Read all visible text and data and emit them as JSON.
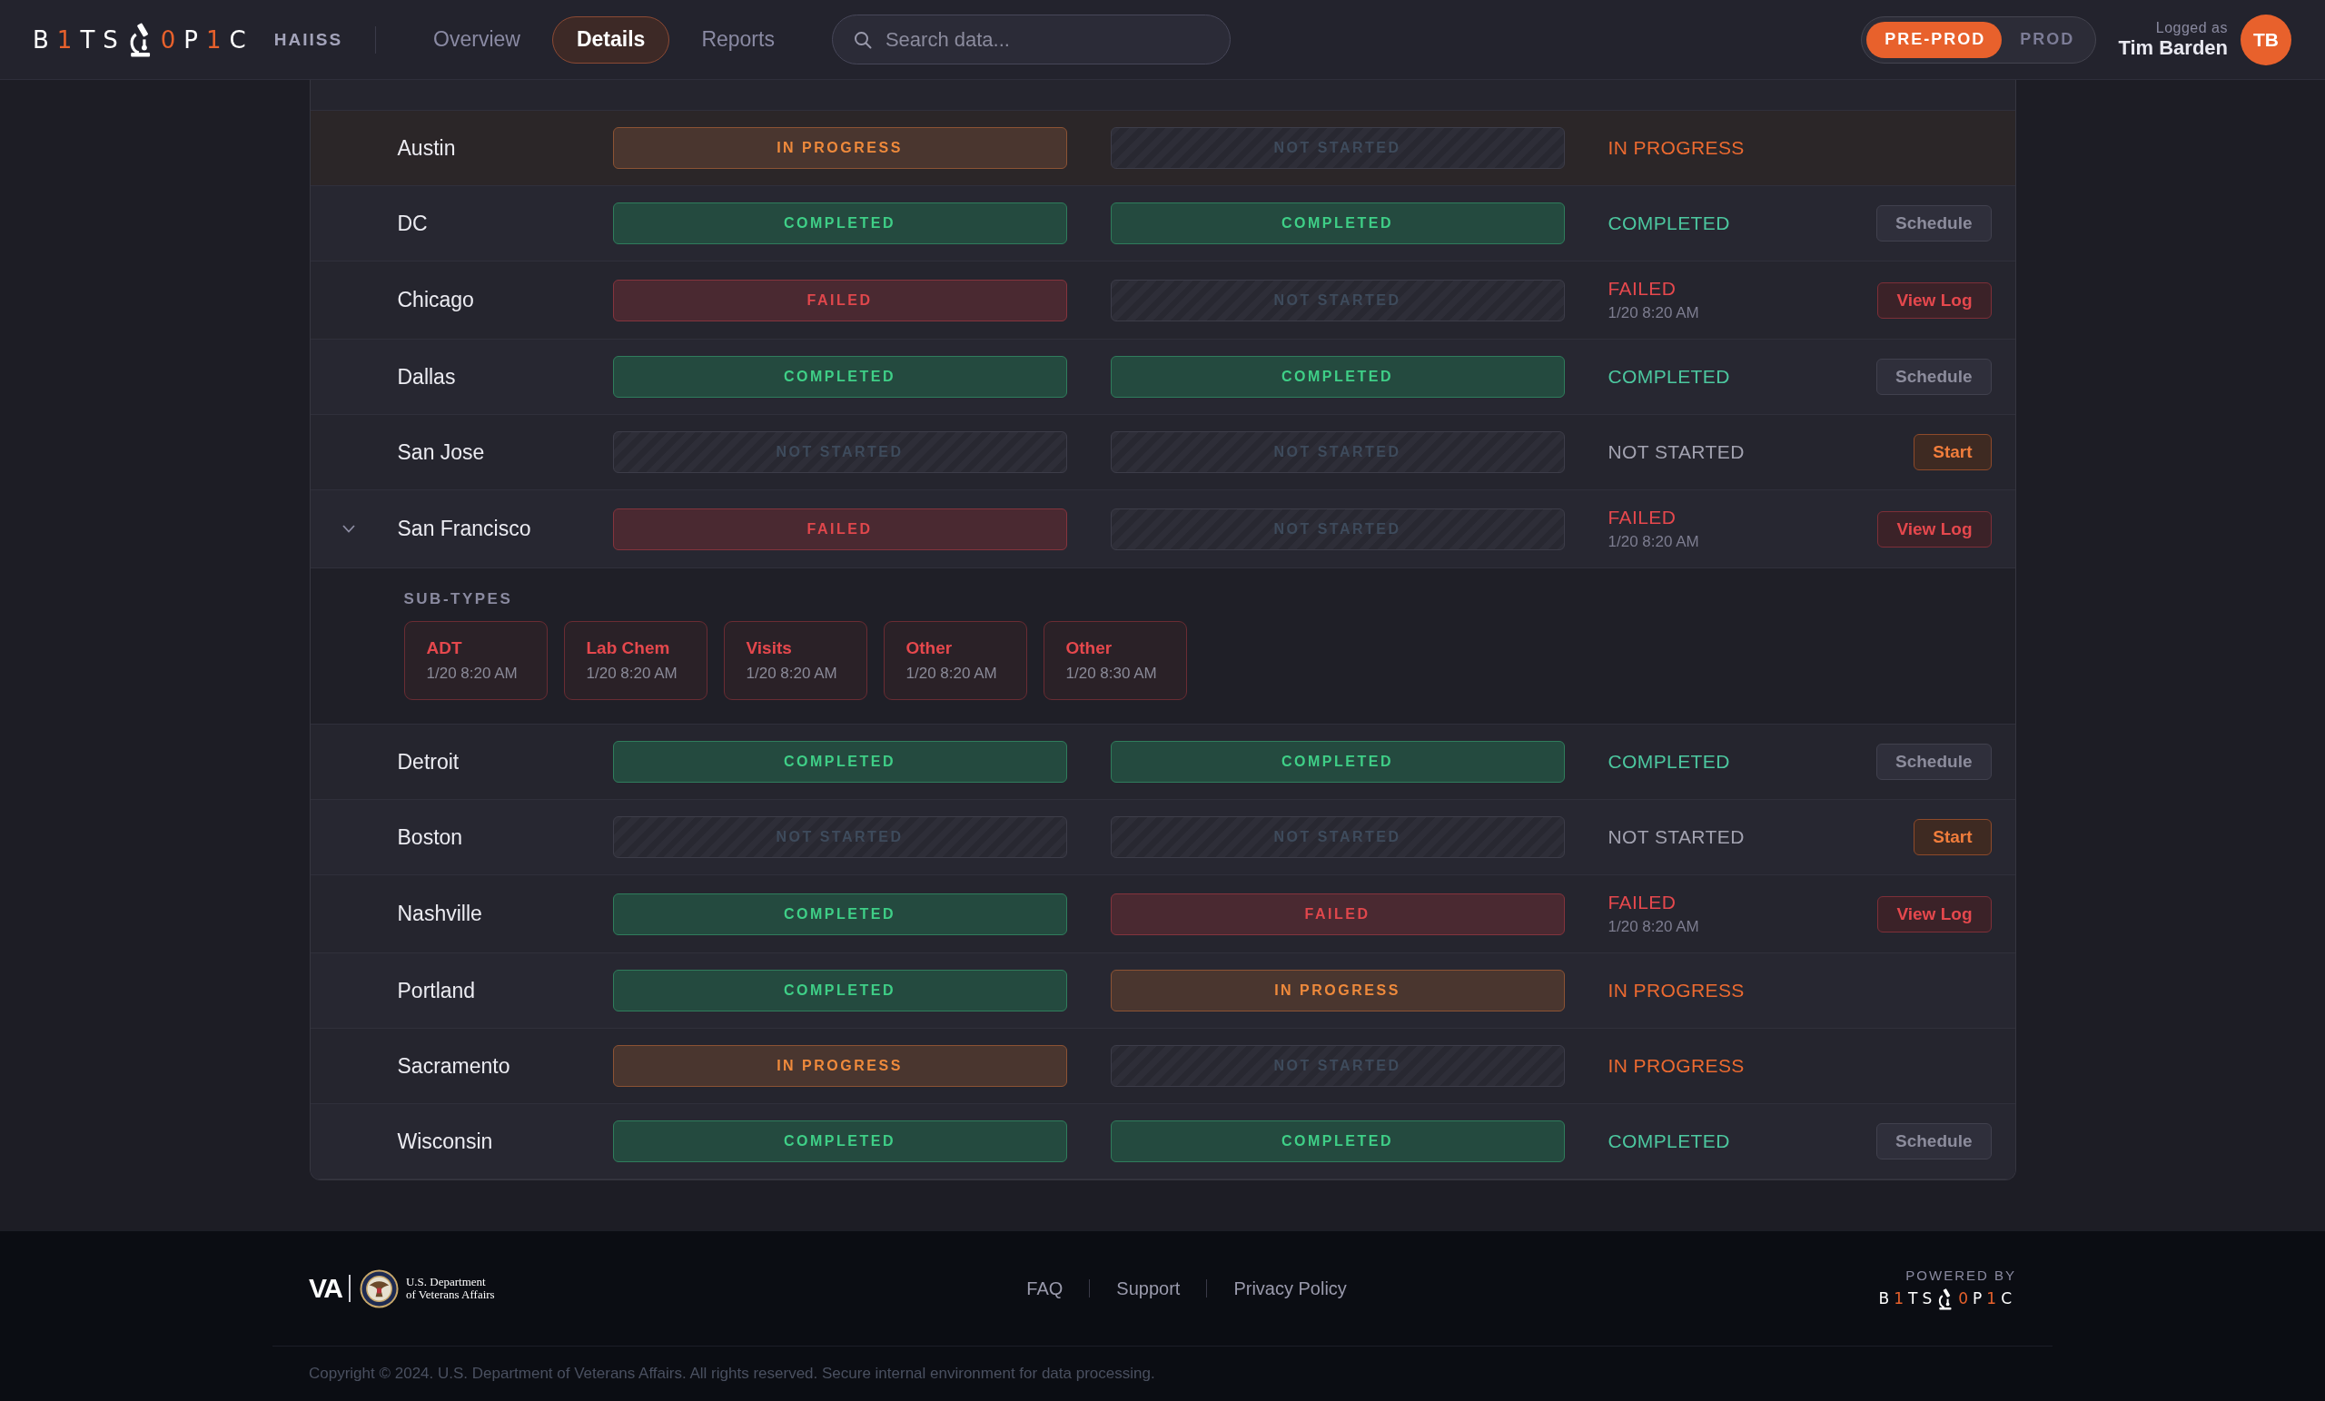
{
  "header": {
    "logo": {
      "before": [
        {
          "text": "B",
          "accent": false
        },
        {
          "text": "1",
          "accent": true
        },
        {
          "text": "TS",
          "accent": false
        }
      ],
      "after": [
        {
          "text": "0",
          "accent": true
        },
        {
          "text": "P",
          "accent": false
        },
        {
          "text": "1",
          "accent": true
        },
        {
          "text": "C",
          "accent": false
        }
      ]
    },
    "app_name": "HAIISS",
    "tabs": [
      {
        "label": "Overview",
        "selected": false
      },
      {
        "label": "Details",
        "selected": true
      },
      {
        "label": "Reports",
        "selected": false
      }
    ],
    "search": {
      "placeholder": "Search data..."
    },
    "environment": [
      {
        "label": "PRE-PROD",
        "selected": true
      },
      {
        "label": "PROD",
        "selected": false
      }
    ],
    "user": {
      "caption": "Logged as",
      "name": "Tim Barden",
      "initials": "TB"
    }
  },
  "table": {
    "rows": [
      {
        "name": "Austin",
        "expanded": false,
        "highlighted": true,
        "column_2": {
          "kind": "in_progress",
          "label": "IN PROGRESS"
        },
        "column_3": {
          "kind": "not_started",
          "label": "NOT STARTED"
        },
        "column_4": {
          "kind": "in_progress",
          "label": "IN PROGRESS"
        }
      },
      {
        "name": "DC",
        "expanded": false,
        "highlighted": false,
        "column_2": {
          "kind": "completed",
          "label": "COMPLETED"
        },
        "column_3": {
          "kind": "completed",
          "label": "COMPLETED"
        },
        "column_4": {
          "kind": "completed",
          "label": "COMPLETED"
        },
        "action": {
          "kind": "schedule",
          "label": "Schedule"
        }
      },
      {
        "name": "Chicago",
        "expanded": false,
        "highlighted": false,
        "column_2": {
          "kind": "failed",
          "label": "FAILED"
        },
        "column_3": {
          "kind": "not_started",
          "label": "NOT STARTED"
        },
        "column_4": {
          "kind": "failed",
          "label": "FAILED",
          "time": "1/20 8:20 AM"
        },
        "action": {
          "kind": "view_log",
          "label": "View Log"
        }
      },
      {
        "name": "Dallas",
        "expanded": false,
        "highlighted": false,
        "column_2": {
          "kind": "completed",
          "label": "COMPLETED"
        },
        "column_3": {
          "kind": "completed",
          "label": "COMPLETED"
        },
        "column_4": {
          "kind": "completed",
          "label": "COMPLETED"
        },
        "action": {
          "kind": "schedule",
          "label": "Schedule"
        }
      },
      {
        "name": "San Jose",
        "expanded": false,
        "highlighted": false,
        "column_2": {
          "kind": "not_started",
          "label": "NOT STARTED"
        },
        "column_3": {
          "kind": "not_started",
          "label": "NOT STARTED"
        },
        "column_4": {
          "kind": "not_started",
          "label": "NOT STARTED"
        },
        "action": {
          "kind": "start",
          "label": "Start"
        }
      },
      {
        "name": "San Francisco",
        "expanded": true,
        "highlighted": false,
        "column_2": {
          "kind": "failed",
          "label": "FAILED"
        },
        "column_3": {
          "kind": "not_started",
          "label": "NOT STARTED"
        },
        "column_4": {
          "kind": "failed",
          "label": "FAILED",
          "time": "1/20 8:20 AM"
        },
        "action": {
          "kind": "view_log",
          "label": "View Log"
        },
        "subtypes": {
          "label": "SUB-TYPES",
          "items": [
            {
              "name": "ADT",
              "time": "1/20 8:20 AM",
              "kind": "failed"
            },
            {
              "name": "Lab Chem",
              "time": "1/20 8:20 AM",
              "kind": "failed"
            },
            {
              "name": "Visits",
              "time": "1/20 8:20 AM",
              "kind": "failed"
            },
            {
              "name": "Other",
              "time": "1/20 8:20 AM",
              "kind": "failed"
            },
            {
              "name": "Other",
              "time": "1/20 8:30 AM",
              "kind": "failed"
            }
          ]
        }
      },
      {
        "name": "Detroit",
        "expanded": false,
        "highlighted": false,
        "column_2": {
          "kind": "completed",
          "label": "COMPLETED"
        },
        "column_3": {
          "kind": "completed",
          "label": "COMPLETED"
        },
        "column_4": {
          "kind": "completed",
          "label": "COMPLETED"
        },
        "action": {
          "kind": "schedule",
          "label": "Schedule"
        }
      },
      {
        "name": "Boston",
        "expanded": false,
        "highlighted": false,
        "column_2": {
          "kind": "not_started",
          "label": "NOT STARTED"
        },
        "column_3": {
          "kind": "not_started",
          "label": "NOT STARTED"
        },
        "column_4": {
          "kind": "not_started",
          "label": "NOT STARTED"
        },
        "action": {
          "kind": "start",
          "label": "Start"
        }
      },
      {
        "name": "Nashville",
        "expanded": false,
        "highlighted": false,
        "column_2": {
          "kind": "completed",
          "label": "COMPLETED"
        },
        "column_3": {
          "kind": "failed",
          "label": "FAILED"
        },
        "column_4": {
          "kind": "failed",
          "label": "FAILED",
          "time": "1/20 8:20 AM"
        },
        "action": {
          "kind": "view_log",
          "label": "View Log"
        }
      },
      {
        "name": "Portland",
        "expanded": false,
        "highlighted": false,
        "column_2": {
          "kind": "completed",
          "label": "COMPLETED"
        },
        "column_3": {
          "kind": "in_progress",
          "label": "IN PROGRESS"
        },
        "column_4": {
          "kind": "in_progress",
          "label": "IN PROGRESS"
        }
      },
      {
        "name": "Sacramento",
        "expanded": false,
        "highlighted": false,
        "column_2": {
          "kind": "in_progress",
          "label": "IN PROGRESS"
        },
        "column_3": {
          "kind": "not_started",
          "label": "NOT STARTED"
        },
        "column_4": {
          "kind": "in_progress",
          "label": "IN PROGRESS"
        }
      },
      {
        "name": "Wisconsin",
        "expanded": false,
        "highlighted": false,
        "column_2": {
          "kind": "completed",
          "label": "COMPLETED"
        },
        "column_3": {
          "kind": "completed",
          "label": "COMPLETED"
        },
        "column_4": {
          "kind": "completed",
          "label": "COMPLETED"
        },
        "action": {
          "kind": "schedule",
          "label": "Schedule"
        }
      }
    ]
  },
  "footer": {
    "agency": {
      "abbreviation": "VA",
      "name_lines": [
        "U.S. Department",
        "of Veterans Affairs"
      ]
    },
    "links": [
      "FAQ",
      "Support",
      "Privacy Policy"
    ],
    "powered_by": {
      "label": "POWERED BY",
      "logo": {
        "before": [
          {
            "text": "B",
            "accent": false
          },
          {
            "text": "1",
            "accent": true
          },
          {
            "text": "TS",
            "accent": false
          }
        ],
        "after": [
          {
            "text": "0",
            "accent": true
          },
          {
            "text": "P",
            "accent": false
          },
          {
            "text": "1",
            "accent": true
          },
          {
            "text": "C",
            "accent": false
          }
        ]
      }
    },
    "copyright": "Copyright © 2024. U.S. Department of Veterans Affairs. All rights reserved. Secure internal environment for data processing."
  }
}
